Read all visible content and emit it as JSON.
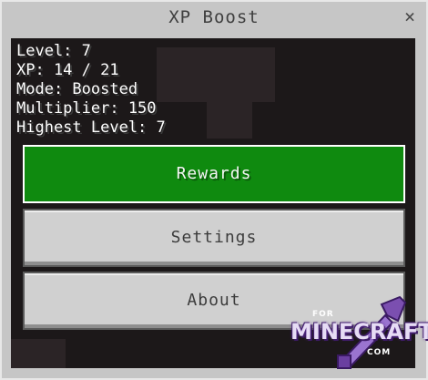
{
  "window": {
    "title": "XP Boost",
    "close_glyph": "×"
  },
  "stats": {
    "level": "Level: 7",
    "xp": "XP: 14 / 21",
    "mode": "Mode: Boosted",
    "multiplier": "Multiplier: 150",
    "highest_level": "Highest Level: 7"
  },
  "buttons": {
    "rewards": "Rewards",
    "settings": "Settings",
    "about": "About"
  },
  "watermark": {
    "prefix": "FOR",
    "name": "MINECRAFT",
    "suffix": "COM"
  },
  "colors": {
    "primary_button": "#0f8a0f",
    "secondary_button": "#d0d0d0",
    "window_frame": "#c6c6c6",
    "content_bg": "#1c1819"
  }
}
